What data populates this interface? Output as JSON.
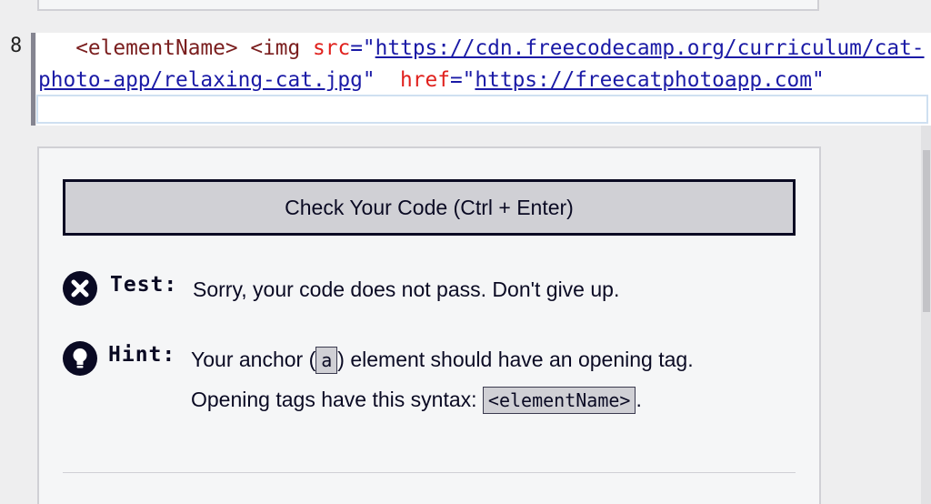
{
  "editor": {
    "line_number": "8",
    "code": {
      "lead": "   ",
      "tag_open": "<elementName>",
      "space1": " ",
      "img_open": "<img",
      "space2": " ",
      "src_attr": "src",
      "eq1": "=\"",
      "src_url": "https://cdn.freecodecamp.org/curriculum/cat-photo-app/relaxing-cat.jpg",
      "close_q1": "\"",
      "space3": "  ",
      "href_attr": "href",
      "eq2": "=\"",
      "href_url": "https://freecatphotoapp.com",
      "close_q2": "\""
    }
  },
  "panel": {
    "check_button_label": "Check Your Code (Ctrl + Enter)",
    "test": {
      "label": "Test:",
      "message": "Sorry, your code does not pass. Don't give up."
    },
    "hint": {
      "label": "Hint:",
      "text_before": "Your anchor (",
      "code_a": "a",
      "text_after": ") element should have an opening tag.",
      "line2_before": "Opening tags have this syntax: ",
      "code_syntax": "<elementName>",
      "line2_after": "."
    }
  },
  "icons": {
    "test": "close-circle-icon",
    "hint": "lightbulb-icon"
  },
  "colors": {
    "primary_dark": "#0a0a23",
    "attr_red": "#e0201c",
    "string_blue": "#1a1aa6",
    "tag_maroon": "#7a1e1e"
  }
}
